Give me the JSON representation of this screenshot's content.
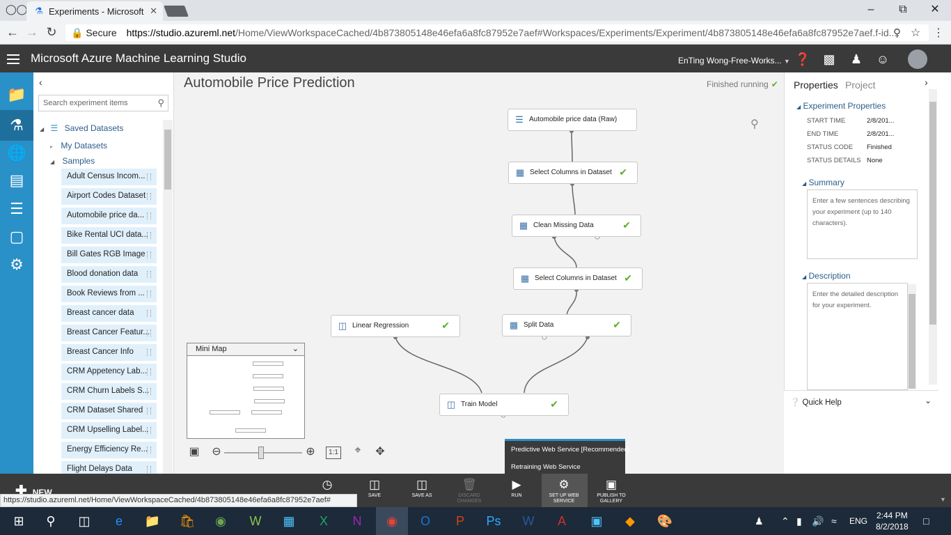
{
  "browser": {
    "tab_title": "Experiments - Microsoft",
    "secure_label": "Secure",
    "url_host": "https://studio.azureml.net",
    "url_path": "/Home/ViewWorkspaceCached/4b873805148e46efa6a8fc87952e7aef#Workspaces/Experiments/Experiment/4b873805148e46efa6a8fc87952e7aef.f-id....",
    "status_url": "https://studio.azureml.net/Home/ViewWorkspaceCached/4b873805148e46efa6a8fc87952e7aef#"
  },
  "app": {
    "title": "Microsoft Azure Machine Learning Studio",
    "workspace": "EnTing Wong-Free-Works..."
  },
  "palette": {
    "search_placeholder": "Search experiment items",
    "saved_datasets": "Saved Datasets",
    "my_datasets": "My Datasets",
    "samples": "Samples",
    "datasets": [
      "Adult Census Incom...",
      "Airport Codes Dataset",
      "Automobile price da...",
      "Bike Rental UCI data...",
      "Bill Gates RGB Image",
      "Blood donation data",
      "Book Reviews from ...",
      "Breast cancer data",
      "Breast Cancer Featur...",
      "Breast Cancer Info",
      "CRM Appetency Lab...",
      "CRM Churn Labels S...",
      "CRM Dataset Shared",
      "CRM Upselling Label...",
      "Energy Efficiency Re...",
      "Flight Delays Data"
    ]
  },
  "canvas": {
    "experiment_title": "Automobile Price Prediction",
    "status": "Finished running",
    "nodes": [
      {
        "label": "Automobile price data (Raw)",
        "done": false
      },
      {
        "label": "Select Columns in Dataset",
        "done": true
      },
      {
        "label": "Clean Missing Data",
        "done": true
      },
      {
        "label": "Select Columns in Dataset",
        "done": true
      },
      {
        "label": "Split Data",
        "done": true
      },
      {
        "label": "Linear Regression",
        "done": true
      },
      {
        "label": "Train Model",
        "done": true
      }
    ],
    "minimap_label": "Mini Map",
    "zoom_fit_label": "1:1"
  },
  "webservice_menu": {
    "items": [
      "Predictive Web Service [Recommended]",
      "Retraining Web Service"
    ]
  },
  "properties": {
    "tab_properties": "Properties",
    "tab_project": "Project",
    "experiment_properties": "Experiment Properties",
    "fields": [
      {
        "key": "START TIME",
        "value": "2/8/201..."
      },
      {
        "key": "END TIME",
        "value": "2/8/201..."
      },
      {
        "key": "STATUS CODE",
        "value": "Finished"
      },
      {
        "key": "STATUS DETAILS",
        "value": "None"
      }
    ],
    "summary_title": "Summary",
    "summary_placeholder": "Enter a few sentences describing your experiment (up to 140 characters).",
    "description_title": "Description",
    "description_placeholder": "Enter the detailed description for your experiment.",
    "quick_help": "Quick Help"
  },
  "toolbar": {
    "new_label": "NEW",
    "buttons": [
      {
        "label": "",
        "icon": "history-icon"
      },
      {
        "label": "SAVE",
        "icon": "save-icon"
      },
      {
        "label": "SAVE AS",
        "icon": "save-as-icon"
      },
      {
        "label": "DISCARD CHANGES",
        "icon": "trash-icon"
      },
      {
        "label": "RUN",
        "icon": "play-icon"
      },
      {
        "label": "SET UP WEB SERVICE",
        "icon": "web-service-icon"
      },
      {
        "label": "PUBLISH TO GALLERY",
        "icon": "gallery-icon"
      }
    ]
  },
  "taskbar": {
    "language": "ENG",
    "time": "2:44 PM",
    "date": "8/2/2018"
  },
  "colors": {
    "rail": "#2a90c8",
    "header": "#3a3a3a",
    "check": "#5cae2e",
    "link": "#2a5d8c"
  }
}
